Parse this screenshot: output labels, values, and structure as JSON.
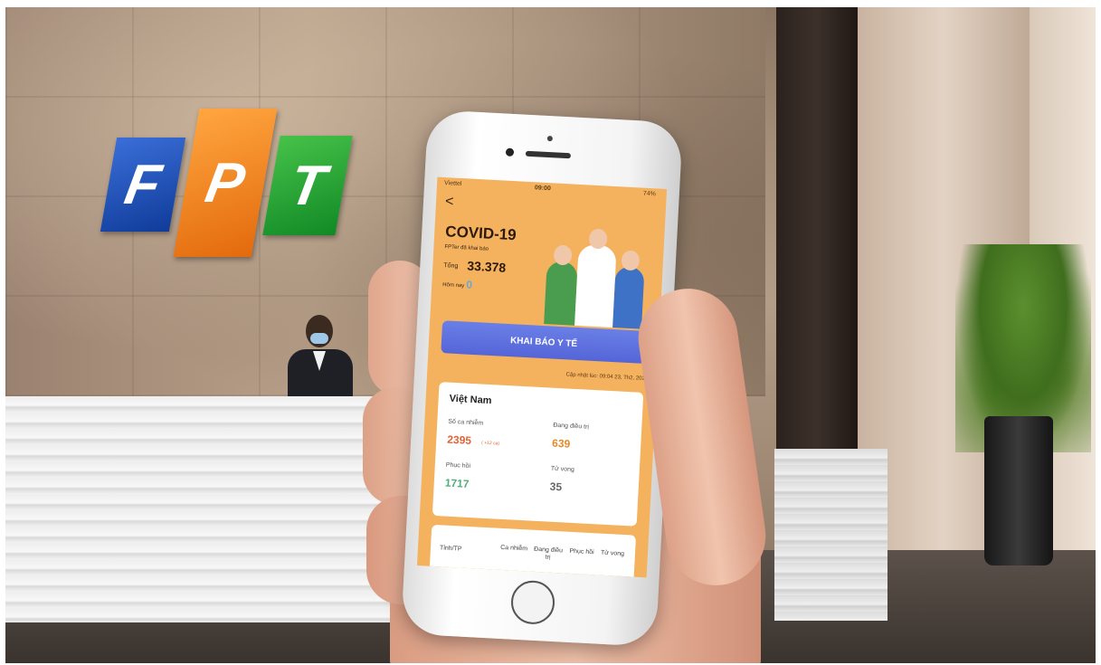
{
  "logo": {
    "letters": [
      "F",
      "P",
      "T"
    ]
  },
  "app": {
    "status_bar": {
      "carrier": "Viettel",
      "time": "09:00",
      "battery": "74%"
    },
    "back_glyph": "<",
    "title": "COVID-19",
    "subtitle": "FPTer đã khai báo",
    "total_label": "Tổng",
    "total_value": "33.378",
    "today_label": "Hôm nay",
    "today_value": "0",
    "cta_label": "KHAI BÁO Y TẾ",
    "updated_text": "Cập nhật lúc: 09:04 23, Th2, 2021",
    "card": {
      "country": "Việt Nam",
      "cases_label": "Số ca nhiễm",
      "cases_value": "2395",
      "cases_delta": "( +12 ca)",
      "treating_label": "Đang điều trị",
      "treating_value": "639",
      "recovered_label": "Phục hồi",
      "recovered_value": "1717",
      "deaths_label": "Tử vong",
      "deaths_value": "35"
    },
    "table_headers": [
      "Tỉnh/TP",
      "Ca nhiễm",
      "Đang điều trị",
      "Phục hồi",
      "Tử vong"
    ]
  },
  "colors": {
    "app_bg": "#f4b25f",
    "cta": "#5d6fe0",
    "cases": "#e06238",
    "treating": "#e48a2c",
    "recovered": "#4fae79",
    "deaths": "#666666"
  }
}
